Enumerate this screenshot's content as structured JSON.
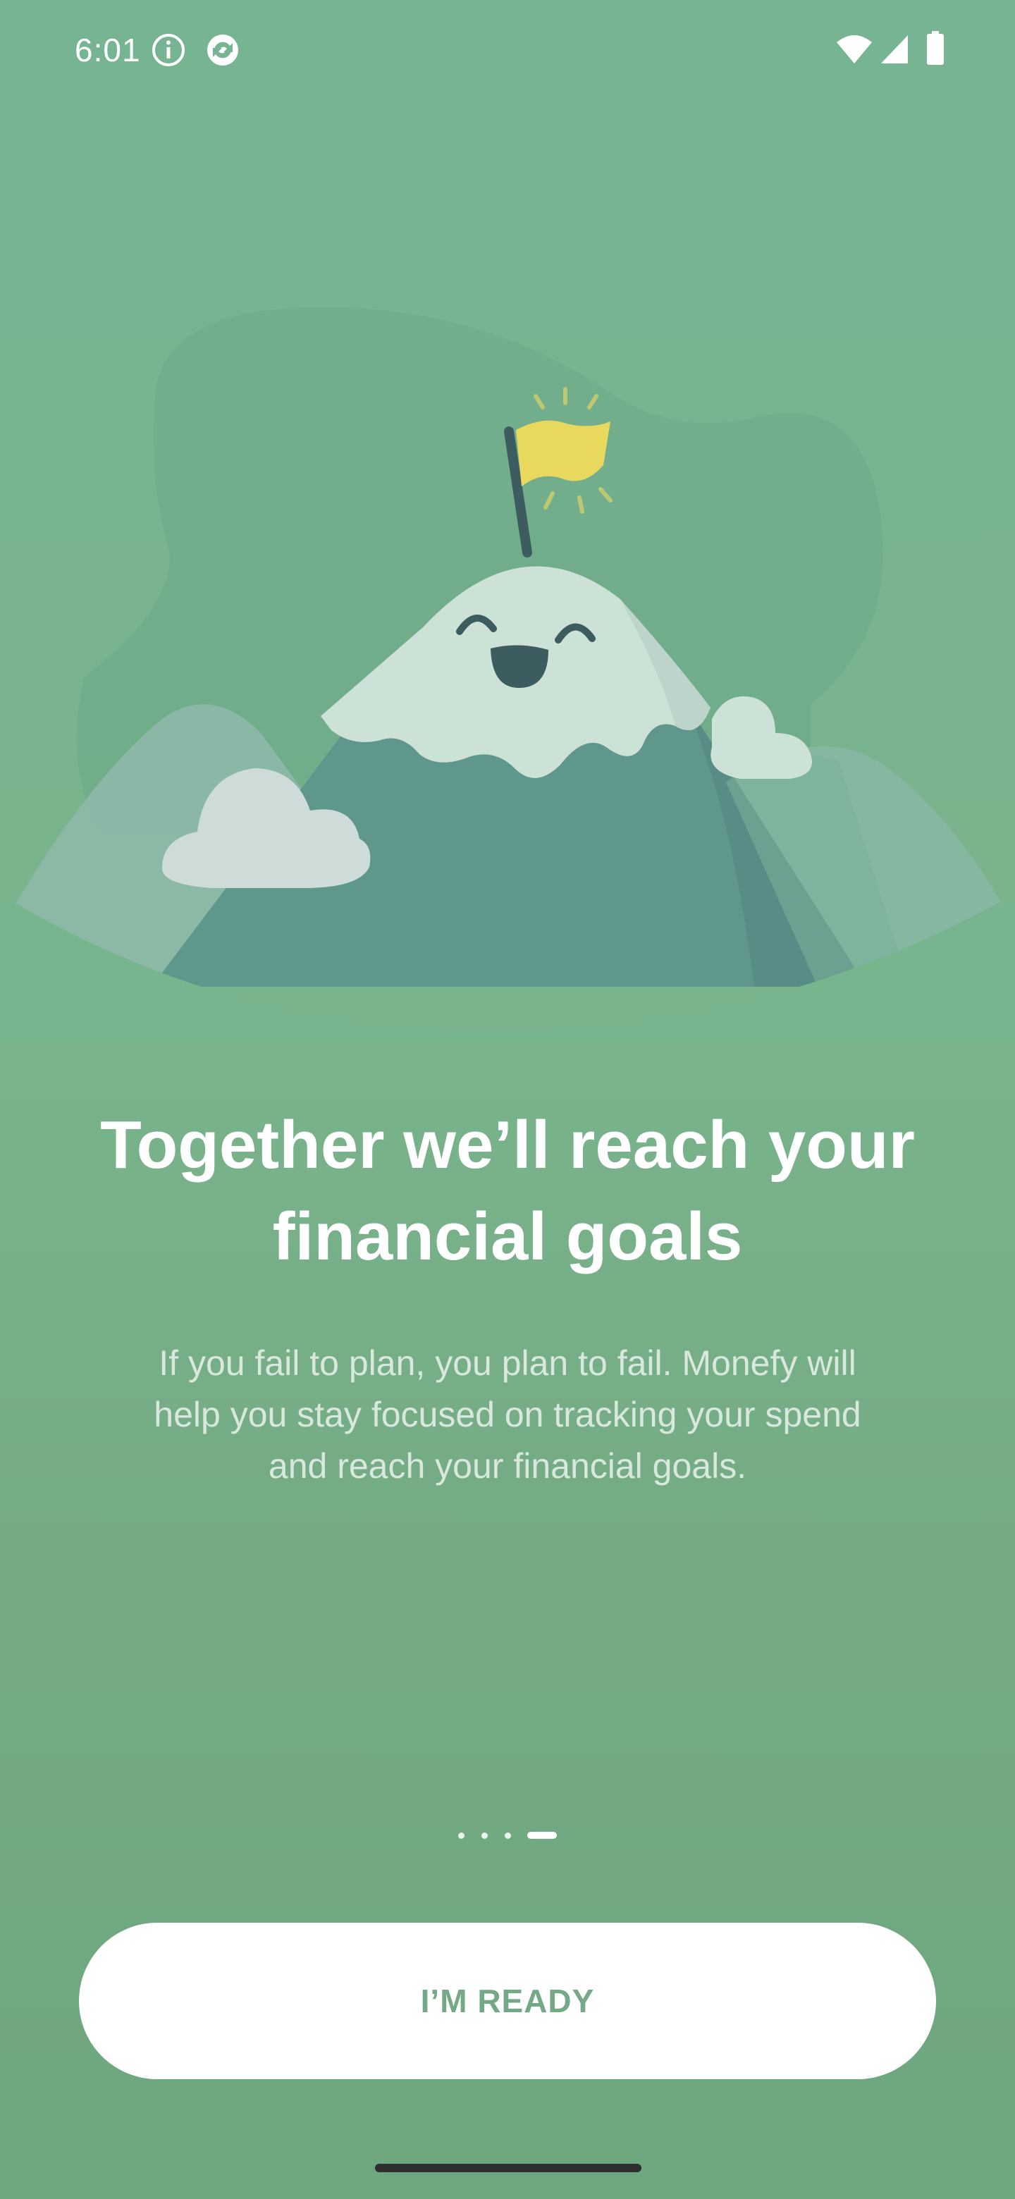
{
  "status_bar": {
    "time": "6:01",
    "left_icons": [
      "info-icon",
      "sync-icon"
    ],
    "right_icons": [
      "wifi-icon",
      "signal-icon",
      "battery-icon"
    ]
  },
  "onboarding": {
    "title": "Together we’ll reach your financial goals",
    "title_line1": "Together we’ll reach your",
    "title_line2": "financial goals",
    "description": "If you fail to plan, you plan to fail. Monefy will help you stay focused on tracking your spend and reach your financial goals.",
    "desc_line1": "If you fail to plan, you plan to fail. Monefy will",
    "desc_line2": "help you stay focused on tracking your spend",
    "desc_line3": "and reach your financial goals.",
    "illustration": "smiling-mountain-with-flag-illustration",
    "pages_total": 4,
    "current_page": 4
  },
  "cta": {
    "label": "I’M READY"
  },
  "colors": {
    "background": "#77b493",
    "mountain": "#5f978d",
    "snow": "#cde2d6",
    "flag": "#e8d95e",
    "face": "#3d5c60",
    "button_text": "#75a887"
  }
}
